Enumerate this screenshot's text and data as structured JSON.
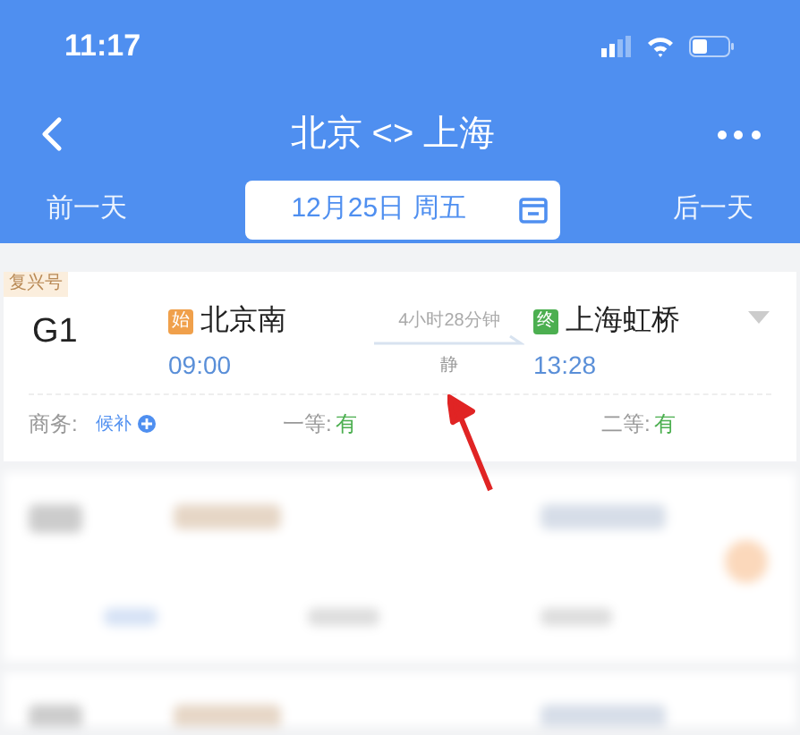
{
  "status_bar": {
    "time": "11:17"
  },
  "nav": {
    "title": "北京 <> 上海"
  },
  "date_bar": {
    "prev": "前一天",
    "date": "12月25日 周五",
    "next": "后一天"
  },
  "train": {
    "type_tag": "复兴号",
    "number": "G1",
    "duration": "4小时28分钟",
    "quiet_tag": "静",
    "stations": [
      {
        "badge": "始",
        "color": "#f0a04b",
        "name": "北京南",
        "time": "09:00"
      },
      {
        "badge": "终",
        "color": "#4caf50",
        "name": "上海虹桥",
        "time": "13:28"
      }
    ],
    "seats": [
      {
        "class": "商务:",
        "availability": "候补",
        "kind": "waitlist"
      },
      {
        "class": "一等:",
        "availability": "有",
        "kind": "available"
      },
      {
        "class": "二等:",
        "availability": "有",
        "kind": "available"
      }
    ]
  }
}
